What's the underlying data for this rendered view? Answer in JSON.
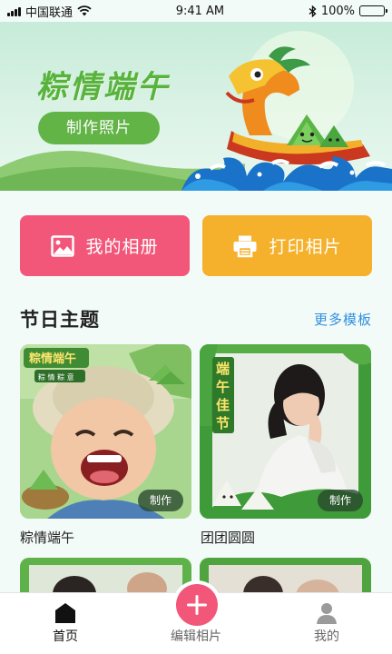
{
  "status_bar": {
    "carrier": "中国联通",
    "time": "9:41 AM",
    "battery": "100%",
    "battery_level": 1.0
  },
  "banner": {
    "title": "粽情端午",
    "button_label": "制作照片"
  },
  "actions": {
    "album_label": "我的相册",
    "print_label": "打印相片"
  },
  "section": {
    "title": "节日主题",
    "more_label": "更多模板"
  },
  "templates": [
    {
      "name": "粽情端午",
      "make_label": "制作",
      "overlay_title": "粽情端午",
      "overlay_sub": "粽 情 粽 意"
    },
    {
      "name": "团团圆圆",
      "make_label": "制作",
      "overlay_title": "端午佳节"
    }
  ],
  "tab_bar": {
    "home_label": "首页",
    "edit_label": "编辑相片",
    "me_label": "我的"
  },
  "colors": {
    "banner_green": "#58b33e",
    "album_pink": "#f2577a",
    "print_orange": "#f5b12b",
    "link_blue": "#2f8fe0"
  },
  "icons": {
    "album": "image-icon",
    "print": "printer-icon",
    "home": "home-icon",
    "edit": "plus-icon",
    "me": "user-icon"
  }
}
